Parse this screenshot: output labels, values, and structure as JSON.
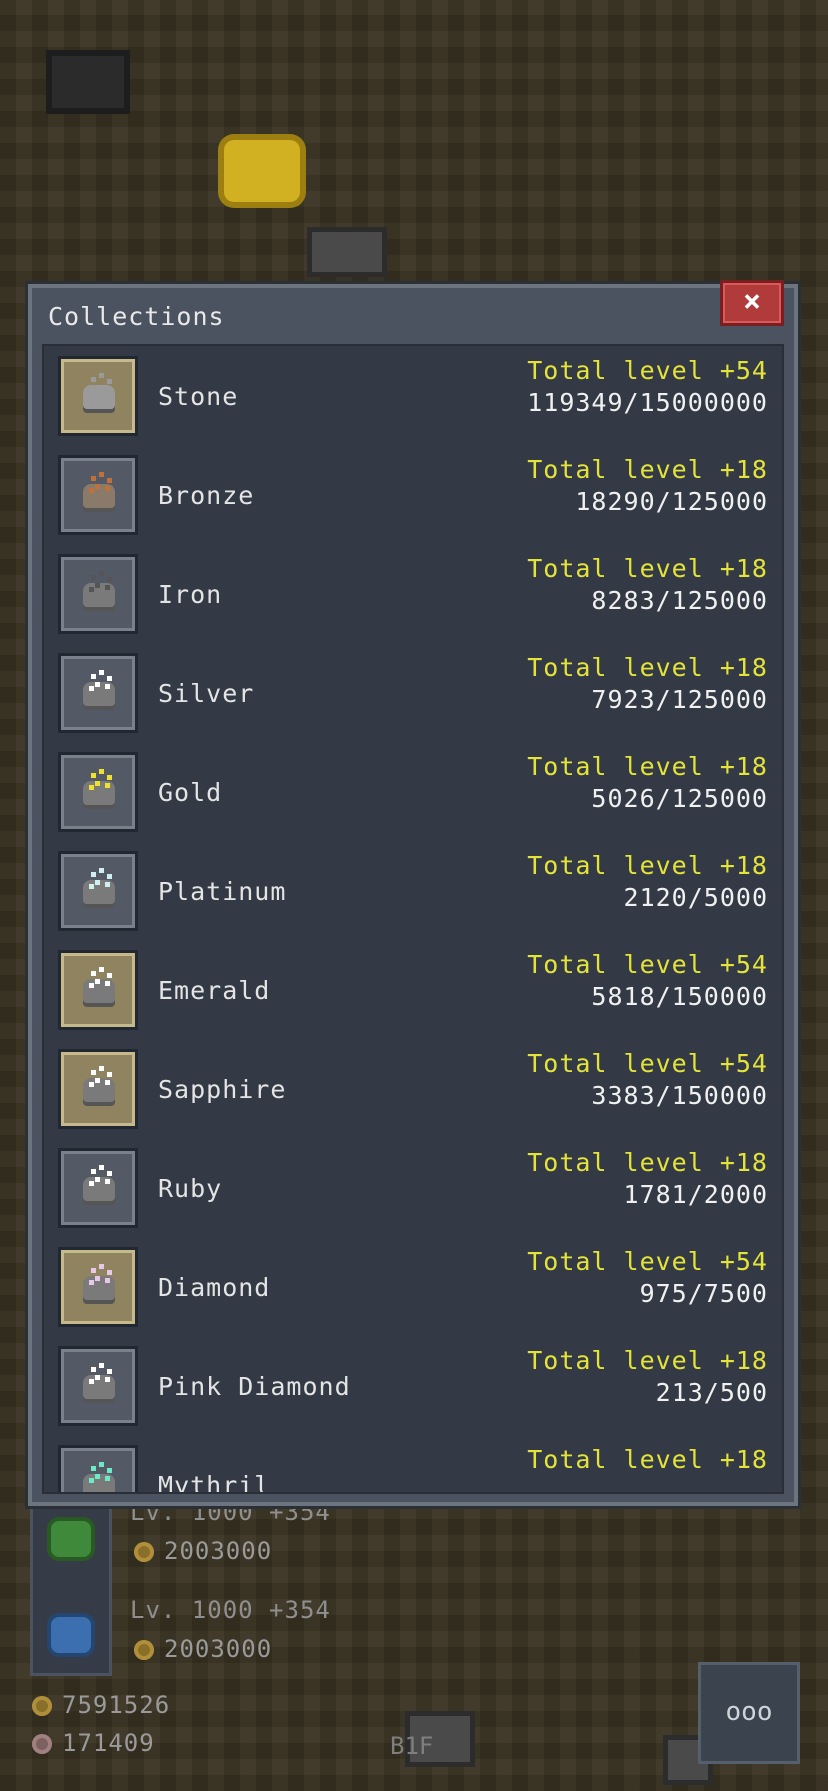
{
  "modal": {
    "title": "Collections",
    "close_label": "×"
  },
  "collections": [
    {
      "name": "Stone",
      "bonus": "Total level +54",
      "progress": "119349/15000000",
      "highlight": true,
      "ore_color": "#9a9a9a",
      "dot_color": "#9a9a9a"
    },
    {
      "name": "Bronze",
      "bonus": "Total level +18",
      "progress": "18290/125000",
      "highlight": false,
      "ore_color": "#8a7a6a",
      "dot_color": "#c0703a"
    },
    {
      "name": "Iron",
      "bonus": "Total level +18",
      "progress": "8283/125000",
      "highlight": false,
      "ore_color": "#7a7a7a",
      "dot_color": "#555555"
    },
    {
      "name": "Silver",
      "bonus": "Total level +18",
      "progress": "7923/125000",
      "highlight": false,
      "ore_color": "#7a7a7a",
      "dot_color": "#ffffff"
    },
    {
      "name": "Gold",
      "bonus": "Total level +18",
      "progress": "5026/125000",
      "highlight": false,
      "ore_color": "#7a7a7a",
      "dot_color": "#f0e030"
    },
    {
      "name": "Platinum",
      "bonus": "Total level +18",
      "progress": "2120/5000",
      "highlight": false,
      "ore_color": "#7a7a7a",
      "dot_color": "#cfeff0"
    },
    {
      "name": "Emerald",
      "bonus": "Total level +54",
      "progress": "5818/150000",
      "highlight": true,
      "ore_color": "#7a7a7a",
      "dot_color": "#ffffff"
    },
    {
      "name": "Sapphire",
      "bonus": "Total level +54",
      "progress": "3383/150000",
      "highlight": true,
      "ore_color": "#7a7a7a",
      "dot_color": "#ffffff"
    },
    {
      "name": "Ruby",
      "bonus": "Total level +18",
      "progress": "1781/2000",
      "highlight": false,
      "ore_color": "#7a7a7a",
      "dot_color": "#ffffff"
    },
    {
      "name": "Diamond",
      "bonus": "Total level +54",
      "progress": "975/7500",
      "highlight": true,
      "ore_color": "#7a7a7a",
      "dot_color": "#e8c8e8"
    },
    {
      "name": "Pink Diamond",
      "bonus": "Total level +18",
      "progress": "213/500",
      "highlight": false,
      "ore_color": "#7a7a7a",
      "dot_color": "#ffffff"
    },
    {
      "name": "Mythril",
      "bonus": "Total level +18",
      "progress": "",
      "highlight": false,
      "ore_color": "#7a7a7a",
      "dot_color": "#6ee8c8"
    }
  ],
  "bottom": {
    "workers": [
      {
        "level": "Lv. 1000 +354",
        "cost": "2003000"
      },
      {
        "level": "Lv. 1000 +354",
        "cost": "2003000"
      }
    ],
    "gold": "7591526",
    "gems": "171409",
    "floor": "B1F",
    "menu_label": "ooo"
  },
  "colors": {
    "bonus": "#e3e33a",
    "close": "#b13a3a",
    "panel": "#343a45"
  }
}
